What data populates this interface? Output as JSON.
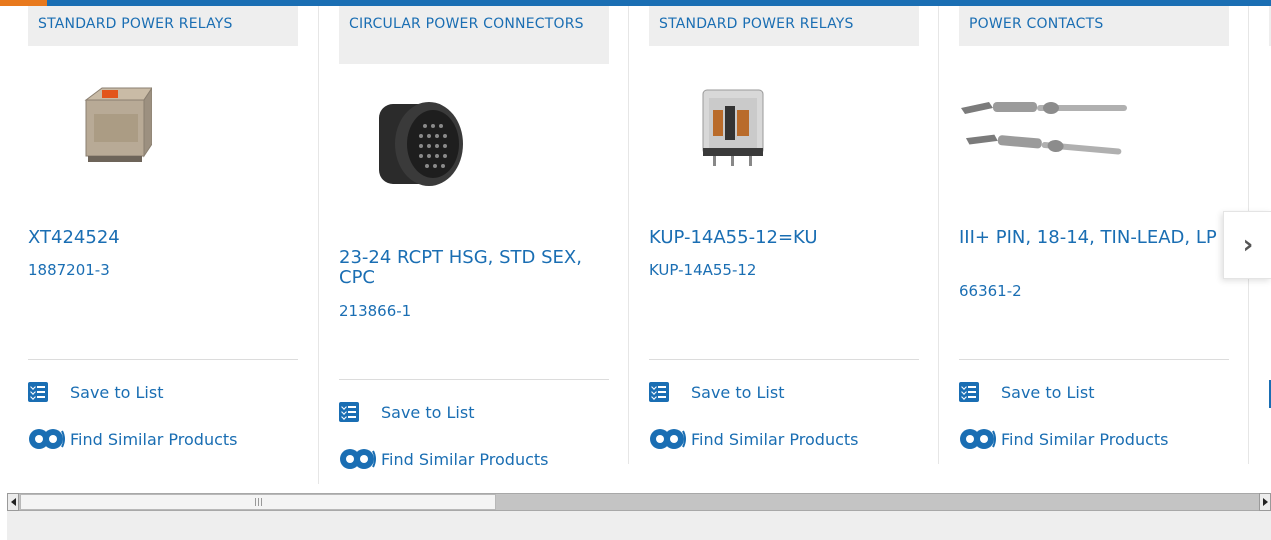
{
  "colors": {
    "accent": "#1a6eb3",
    "highlight": "#e8791d",
    "category_bg": "#eeeeee"
  },
  "cards": [
    {
      "category": "STANDARD POWER RELAYS",
      "image_icon": "relay-cube-orange-image",
      "name": "XT424524",
      "part_number": "1887201-3",
      "save_label": "Save to List",
      "similar_label": "Find Similar Products"
    },
    {
      "category": "CIRCULAR POWER CONNECTORS",
      "image_icon": "circular-connector-image",
      "name": "23-24 RCPT HSG, STD SEX, CPC",
      "part_number": "213866-1",
      "save_label": "Save to List",
      "similar_label": "Find Similar Products"
    },
    {
      "category": "STANDARD POWER RELAYS",
      "image_icon": "relay-clear-cube-image",
      "name": "KUP-14A55-12=KU",
      "part_number": "KUP-14A55-12",
      "save_label": "Save to List",
      "similar_label": "Find Similar Products"
    },
    {
      "category": "POWER CONTACTS",
      "image_icon": "power-contact-pins-image",
      "name": "III+ PIN, 18-14, TIN-LEAD, LP",
      "part_number": "66361-2",
      "save_label": "Save to List",
      "similar_label": "Find Similar Products"
    }
  ],
  "carousel": {
    "next_icon": "chevron-right-icon",
    "next_glyph": "›"
  },
  "scrollbar": {
    "left_icon": "scroll-left-arrow-icon",
    "right_icon": "scroll-right-arrow-icon",
    "position_fraction": 0.0
  }
}
